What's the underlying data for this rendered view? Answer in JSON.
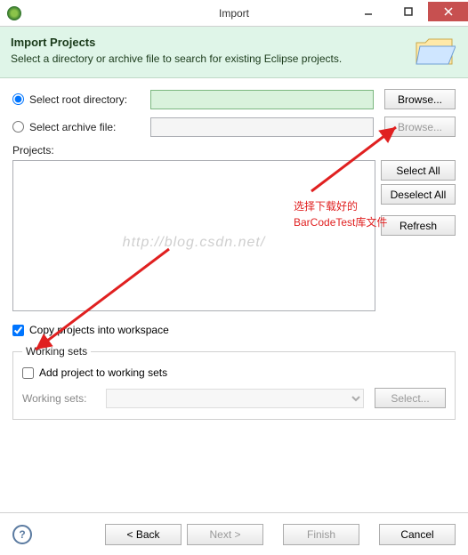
{
  "window": {
    "title": "Import"
  },
  "header": {
    "title": "Import Projects",
    "subtitle": "Select a directory or archive file to search for existing Eclipse projects."
  },
  "radio": {
    "root_label": "Select root directory:",
    "archive_label": "Select archive file:",
    "browse": "Browse..."
  },
  "projects": {
    "label": "Projects:",
    "select_all": "Select All",
    "deselect_all": "Deselect All",
    "refresh": "Refresh"
  },
  "copy": {
    "label": "Copy projects into workspace"
  },
  "working_sets": {
    "legend": "Working sets",
    "add_label": "Add project to working sets",
    "ws_label": "Working sets:",
    "select": "Select..."
  },
  "footer": {
    "back": "< Back",
    "next": "Next >",
    "finish": "Finish",
    "cancel": "Cancel"
  },
  "watermark": "http://blog.csdn.net/",
  "annotation": {
    "line1": "选择下载好的",
    "line2": "BarCodeTest库文件"
  }
}
